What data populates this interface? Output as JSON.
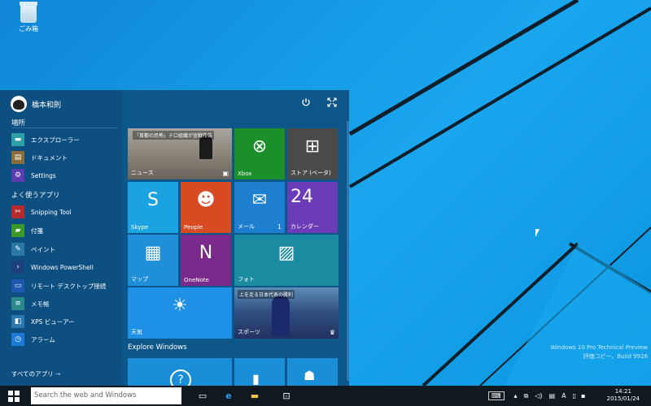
{
  "desktop": {
    "recycle_label": "ごみ箱",
    "watermark_line1": "Windows 10 Pro Technical Preview",
    "watermark_line2": "評価コピー。Build 9926"
  },
  "start": {
    "user_name": "橋本和則",
    "section_places": "場所",
    "places": [
      {
        "label": "エクスプローラー",
        "icon": "folder-icon",
        "color": "#2aa1a8"
      },
      {
        "label": "ドキュメント",
        "icon": "documents-icon",
        "color": "#8a6d3b"
      },
      {
        "label": "Settings",
        "icon": "gear-icon",
        "color": "#5b3db3"
      }
    ],
    "section_frequent": "よく使うアプリ",
    "frequent": [
      {
        "label": "Snipping Tool",
        "icon": "scissors-icon",
        "color": "#b52a2a"
      },
      {
        "label": "付箋",
        "icon": "sticky-notes-icon",
        "color": "#3a9a2a"
      },
      {
        "label": "ペイント",
        "icon": "paint-icon",
        "color": "#2a7aa8"
      },
      {
        "label": "Windows PowerShell",
        "icon": "powershell-icon",
        "color": "#1d3f7a"
      },
      {
        "label": "リモート デスクトップ接続",
        "icon": "remote-desktop-icon",
        "color": "#1f58b0"
      },
      {
        "label": "メモ帳",
        "icon": "notepad-icon",
        "color": "#2a8a8a"
      },
      {
        "label": "XPS ビューアー",
        "icon": "xps-icon",
        "color": "#2a7ab0"
      },
      {
        "label": "アラーム",
        "icon": "alarm-icon",
        "color": "#1d7ad6"
      }
    ],
    "all_apps": "すべてのアプリ ⇾",
    "tiles": {
      "news": {
        "label": "ニュース",
        "headline": "「首都の恐怖」テロ組織が宣戦布告"
      },
      "xbox": {
        "label": "Xbox"
      },
      "store": {
        "label": "ストア (ベータ)"
      },
      "skype": {
        "label": "Skype"
      },
      "people": {
        "label": "People"
      },
      "mail": {
        "label": "メール",
        "count": "1"
      },
      "calendar": {
        "label": "カレンダー",
        "day": "24"
      },
      "maps": {
        "label": "マップ"
      },
      "onenote": {
        "label": "OneNote"
      },
      "photos": {
        "label": "フォト"
      },
      "weather": {
        "label": "天気"
      },
      "sports": {
        "label": "スポーツ",
        "headline": "上を走る日本代表の勝利"
      }
    },
    "explore_heading": "Explore Windows"
  },
  "taskbar": {
    "search_placeholder": "Search the web and Windows",
    "ime": "A",
    "time": "14:21",
    "date": "2015/01/24"
  },
  "colors": {
    "xbox": "#1a8f2a",
    "store": "#4a4a4a",
    "skype": "#1aa3e0",
    "people": "#d84a22",
    "mail": "#1e7fd0",
    "calendar": "#6a3cb8",
    "maps": "#1e8fd8",
    "onenote": "#7a2a8a",
    "photos": "#1a8ba0",
    "weather": "#1e90e6",
    "explore": "#1a8fd8"
  }
}
